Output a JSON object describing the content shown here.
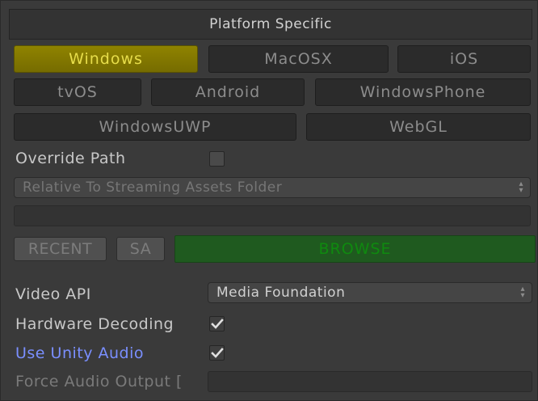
{
  "header": {
    "title": "Platform Specific"
  },
  "platforms": {
    "windows": "Windows",
    "macosx": "MacOSX",
    "ios": "iOS",
    "tvos": "tvOS",
    "android": "Android",
    "windowsphone": "WindowsPhone",
    "windowsuwp": "WindowsUWP",
    "webgl": "WebGL",
    "selected": "Windows",
    "colors": {
      "selected_bg": "#8f8300",
      "selected_text": "#e7dd4a"
    }
  },
  "override_path": {
    "label": "Override Path",
    "checked": false,
    "relative_to": "Relative To Streaming Assets Folder",
    "path_value": ""
  },
  "path_buttons": {
    "recent": "RECENT",
    "sa": "SA",
    "browse": "BROWSE",
    "browse_color": "#1f5a1f"
  },
  "video_api": {
    "label": "Video API",
    "value": "Media Foundation"
  },
  "hardware_decoding": {
    "label": "Hardware Decoding",
    "checked": true
  },
  "use_unity_audio": {
    "label": "Use Unity Audio",
    "checked": true,
    "label_color": "#7a8fff"
  },
  "force_audio_output": {
    "label": "Force Audio Output [",
    "value": ""
  },
  "icons": {
    "check": "checkmark-icon",
    "dropdown": "dropdown-arrows-icon"
  }
}
